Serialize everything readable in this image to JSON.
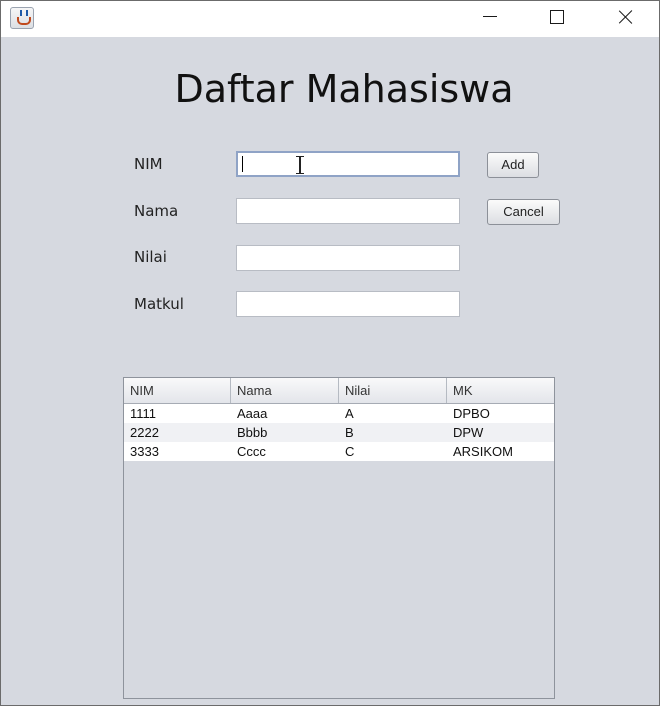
{
  "window": {
    "icon": "java-cup-icon"
  },
  "form": {
    "title": "Daftar Mahasiswa",
    "labels": {
      "nim": "NIM",
      "nama": "Nama",
      "nilai": "Nilai",
      "matkul": "Matkul"
    },
    "values": {
      "nim": "",
      "nama": "",
      "nilai": "",
      "matkul": ""
    },
    "buttons": {
      "add": "Add",
      "cancel": "Cancel"
    }
  },
  "table": {
    "columns": [
      "NIM",
      "Nama",
      "Nilai",
      "MK"
    ],
    "rows": [
      [
        "1111",
        "Aaaa",
        "A",
        "DPBO"
      ],
      [
        "2222",
        "Bbbb",
        "B",
        "DPW"
      ],
      [
        "3333",
        "Cccc",
        "C",
        "ARSIKOM"
      ]
    ]
  }
}
